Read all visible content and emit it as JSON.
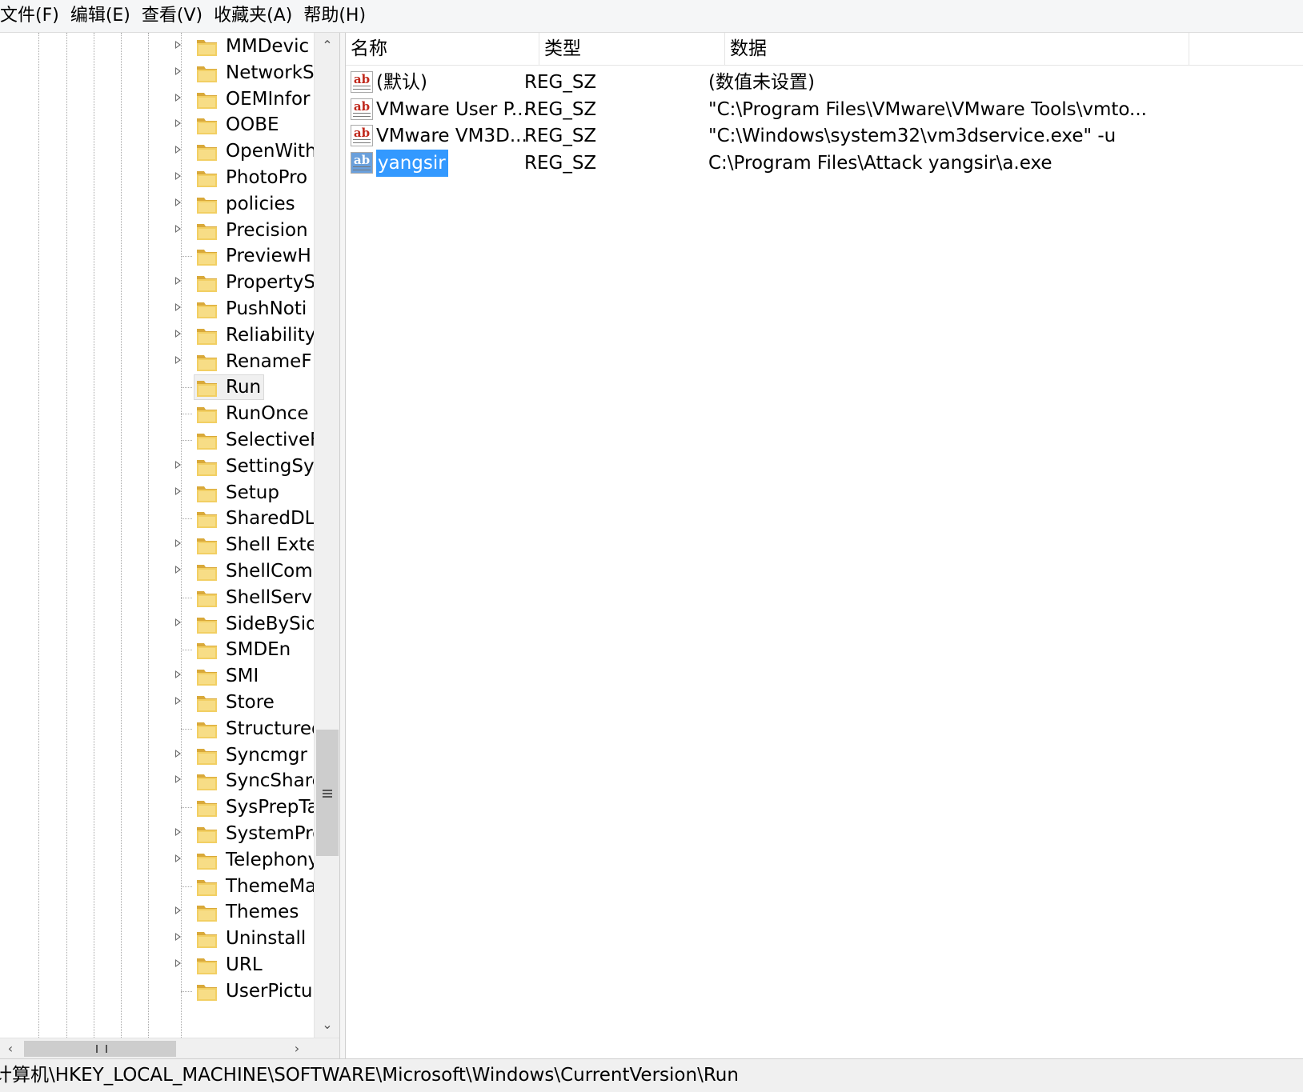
{
  "menu": [
    "文件(F)",
    "编辑(E)",
    "查看(V)",
    "收藏夹(A)",
    "帮助(H)"
  ],
  "tree": {
    "items": [
      {
        "label": "MMDevic",
        "expandable": true
      },
      {
        "label": "NetworkS",
        "expandable": true
      },
      {
        "label": "OEMInfor",
        "expandable": true
      },
      {
        "label": "OOBE",
        "expandable": true
      },
      {
        "label": "OpenWith",
        "expandable": true
      },
      {
        "label": "PhotoPro",
        "expandable": true
      },
      {
        "label": "policies",
        "expandable": true
      },
      {
        "label": "Precision",
        "expandable": true
      },
      {
        "label": "PreviewH",
        "expandable": false
      },
      {
        "label": "PropertyS",
        "expandable": true
      },
      {
        "label": "PushNoti",
        "expandable": true
      },
      {
        "label": "Reliability",
        "expandable": true
      },
      {
        "label": "RenameF",
        "expandable": true
      },
      {
        "label": "Run",
        "expandable": false,
        "selected": true
      },
      {
        "label": "RunOnce",
        "expandable": false
      },
      {
        "label": "SelectiveF",
        "expandable": false
      },
      {
        "label": "SettingSy",
        "expandable": true
      },
      {
        "label": "Setup",
        "expandable": true
      },
      {
        "label": "SharedDL",
        "expandable": false
      },
      {
        "label": "Shell Exte",
        "expandable": true
      },
      {
        "label": "ShellCom",
        "expandable": true
      },
      {
        "label": "ShellServi",
        "expandable": false
      },
      {
        "label": "SideBySid",
        "expandable": true
      },
      {
        "label": "SMDEn",
        "expandable": false
      },
      {
        "label": "SMI",
        "expandable": true
      },
      {
        "label": "Store",
        "expandable": true
      },
      {
        "label": "Structured",
        "expandable": false
      },
      {
        "label": "Syncmgr",
        "expandable": true
      },
      {
        "label": "SyncShare",
        "expandable": true
      },
      {
        "label": "SysPrepTa",
        "expandable": false
      },
      {
        "label": "SystemPro",
        "expandable": true
      },
      {
        "label": "Telephony",
        "expandable": true
      },
      {
        "label": "ThemeMa",
        "expandable": false
      },
      {
        "label": "Themes",
        "expandable": true
      },
      {
        "label": "Uninstall",
        "expandable": true
      },
      {
        "label": "URL",
        "expandable": true
      },
      {
        "label": "UserPictu",
        "expandable": false
      }
    ],
    "scroll_up": "^",
    "scroll_down": "v",
    "scroll_left": "<",
    "scroll_right": ">"
  },
  "list": {
    "columns": [
      "名称",
      "类型",
      "数据"
    ],
    "rows": [
      {
        "icon": "ab",
        "name": "(默认)",
        "type": "REG_SZ",
        "data": "(数值未设置)"
      },
      {
        "icon": "ab",
        "name": "VMware User P...",
        "type": "REG_SZ",
        "data": "\"C:\\Program Files\\VMware\\VMware Tools\\vmto..."
      },
      {
        "icon": "ab",
        "name": "VMware VM3D...",
        "type": "REG_SZ",
        "data": "\"C:\\Windows\\system32\\vm3dservice.exe\" -u"
      },
      {
        "icon": "ab",
        "name": "yangsir",
        "type": "REG_SZ",
        "data": "C:\\Program Files\\Attack yangsir\\a.exe",
        "selected": true
      }
    ]
  },
  "status": {
    "path": "计算机\\HKEY_LOCAL_MACHINE\\SOFTWARE\\Microsoft\\Windows\\CurrentVersion\\Run"
  },
  "colors": {
    "selection": "#3399ff",
    "folder": "#e8c14a",
    "reg_icon_text": "#c0281c"
  }
}
